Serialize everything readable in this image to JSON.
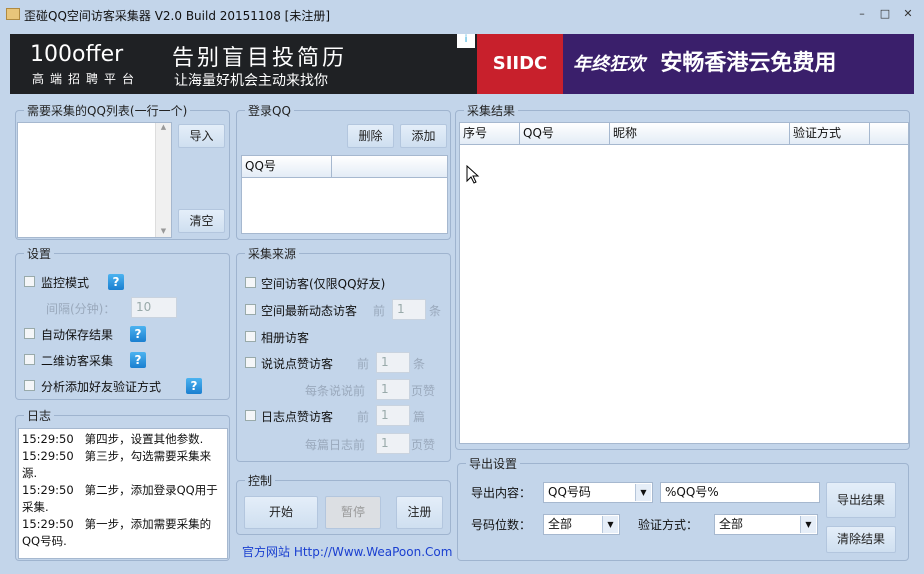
{
  "window": {
    "title": "歪碰QQ空间访客采集器 V2.0 Build 20151108 [未注册]",
    "min": "–",
    "max": "□",
    "close": "✕"
  },
  "ad": {
    "brand": "100offer",
    "brand_sub": "高端招聘平台",
    "headline": "告别盲目投简历",
    "sub": "让海量好机会主动来找你",
    "logo2": "SIIDC",
    "slogan2": "年终狂欢",
    "headline2": "安畅香港云免费用",
    "info": "i"
  },
  "qq_list": {
    "title": "需要采集的QQ列表(一行一个)",
    "import": "导入",
    "clear": "清空"
  },
  "login": {
    "title": "登录QQ",
    "delete": "删除",
    "add": "添加",
    "col": "QQ号"
  },
  "results": {
    "title": "采集结果",
    "cols": [
      "序号",
      "QQ号",
      "昵称",
      "验证方式"
    ]
  },
  "settings": {
    "title": "设置",
    "monitor": "监控模式",
    "interval_label": "间隔(分钟)：",
    "interval": "10",
    "autosave": "自动保存结果",
    "second": "二维访客采集",
    "analyze": "分析添加好友验证方式",
    "help": "?"
  },
  "log": {
    "title": "日志",
    "entries": [
      {
        "time": "15:29:50",
        "msg": "第四步，设置其他参数."
      },
      {
        "time": "15:29:50",
        "msg": "第三步，勾选需要采集来源."
      },
      {
        "time": "15:29:50",
        "msg": "第二步，添加登录QQ用于采集."
      },
      {
        "time": "15:29:50",
        "msg": "第一步，添加需要采集的QQ号码."
      }
    ]
  },
  "source": {
    "title": "采集来源",
    "visitor": "空间访客(仅限QQ好友)",
    "latest": "空间最新动态访客",
    "album": "相册访客",
    "shuo": "说说点赞访客",
    "per_shuo": "每条说说前",
    "blog": "日志点赞访客",
    "per_blog": "每篇日志前",
    "qian": "前",
    "tiao": "条",
    "pian": "篇",
    "ye": "页赞",
    "v1": "1"
  },
  "control": {
    "title": "控制",
    "start": "开始",
    "pause": "暂停",
    "register": "注册"
  },
  "link": "官方网站 Http://Www.WeaPoon.Com",
  "export": {
    "title": "导出设置",
    "content_label": "导出内容：",
    "content": "QQ号码",
    "format": "%QQ号%",
    "digits_label": "号码位数：",
    "digits": "全部",
    "verify_label": "验证方式：",
    "verify": "全部",
    "export_btn": "导出结果",
    "clear_btn": "清除结果"
  }
}
